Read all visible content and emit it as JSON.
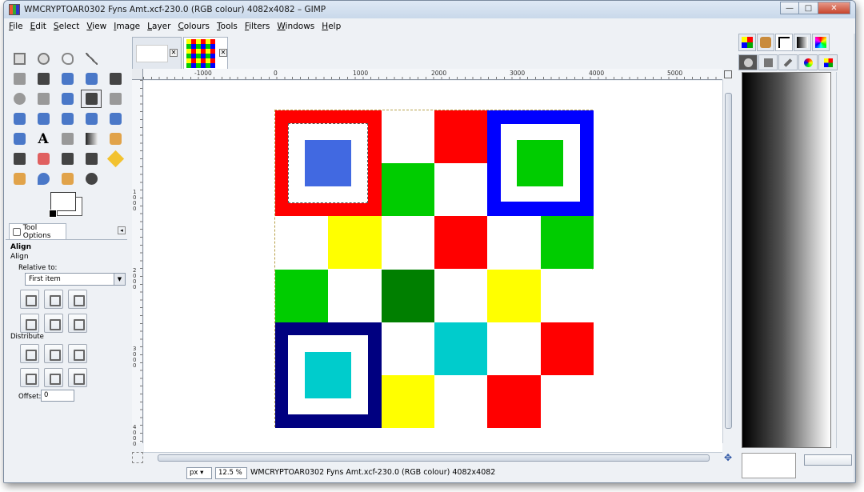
{
  "window": {
    "title": "WMCRYPTOAR0302 Fyns Amt.xcf-230.0 (RGB colour) 4082x4082 – GIMP",
    "minimize": "—",
    "maximize": "□",
    "close": "✕"
  },
  "menu": [
    "File",
    "Edit",
    "Select",
    "View",
    "Image",
    "Layer",
    "Colours",
    "Tools",
    "Filters",
    "Windows",
    "Help"
  ],
  "tool_options": {
    "tab_label": "Tool Options",
    "title": "Align",
    "subtitle": "Align",
    "relative_to_label": "Relative to:",
    "relative_to_value": "First item",
    "distribute_label": "Distribute",
    "offset_label": "Offset:",
    "offset_value": "0"
  },
  "ruler": {
    "h_labels": [
      "-1000",
      "0",
      "1000",
      "2000",
      "3000",
      "4000",
      "5000"
    ],
    "v_labels": [
      "1000",
      "2000",
      "3000",
      "4000"
    ]
  },
  "status": {
    "unit": "px",
    "zoom": "12.5 %",
    "text": "WMCRYPTOAR0302 Fyns Amt.xcf-230.0 (RGB colour) 4082x4082"
  },
  "image_colors": {
    "red": "#ff0000",
    "blue": "#0000ff",
    "navy": "#000080",
    "green": "#00cc00",
    "dark_green": "#007f00",
    "yellow": "#ffff00",
    "cyan": "#00cccc",
    "royal_blue": "#4169e1",
    "white": "#ffffff"
  }
}
